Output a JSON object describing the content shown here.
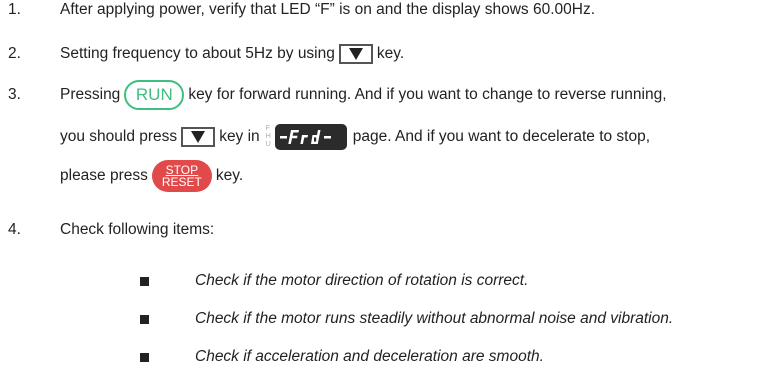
{
  "steps": [
    {
      "num": "1.",
      "text": "After applying power, verify that LED “F” is on and the display shows 60.00Hz."
    },
    {
      "num": "2.",
      "pre": "Setting frequency to about 5Hz by using",
      "key_icon": "down-arrow-key",
      "post": "key."
    },
    {
      "num": "3.",
      "pre": "Pressing",
      "run_label": "RUN",
      "post": "key for forward running. And if you want to change to reverse running,",
      "line2_pre": "you should press",
      "line2_mid": "key in",
      "indicators": [
        "F",
        "H",
        "U"
      ],
      "display_text": "-Frd-",
      "line2_post": "page. And if you want to decelerate to stop,",
      "line3_pre": "please press",
      "stop_label": "STOP",
      "reset_label": "RESET",
      "line3_post": "key."
    },
    {
      "num": "4.",
      "text": "Check following items:"
    }
  ],
  "checks": [
    "Check if the motor direction of rotation is correct.",
    "Check if the motor runs steadily without abnormal noise and vibration.",
    "Check if acceleration and deceleration are smooth."
  ],
  "colors": {
    "run": "#3fbf7f",
    "stop": "#e04a4a",
    "lcd_bg": "#2b2b2b",
    "lcd_fg": "#ffffff"
  }
}
